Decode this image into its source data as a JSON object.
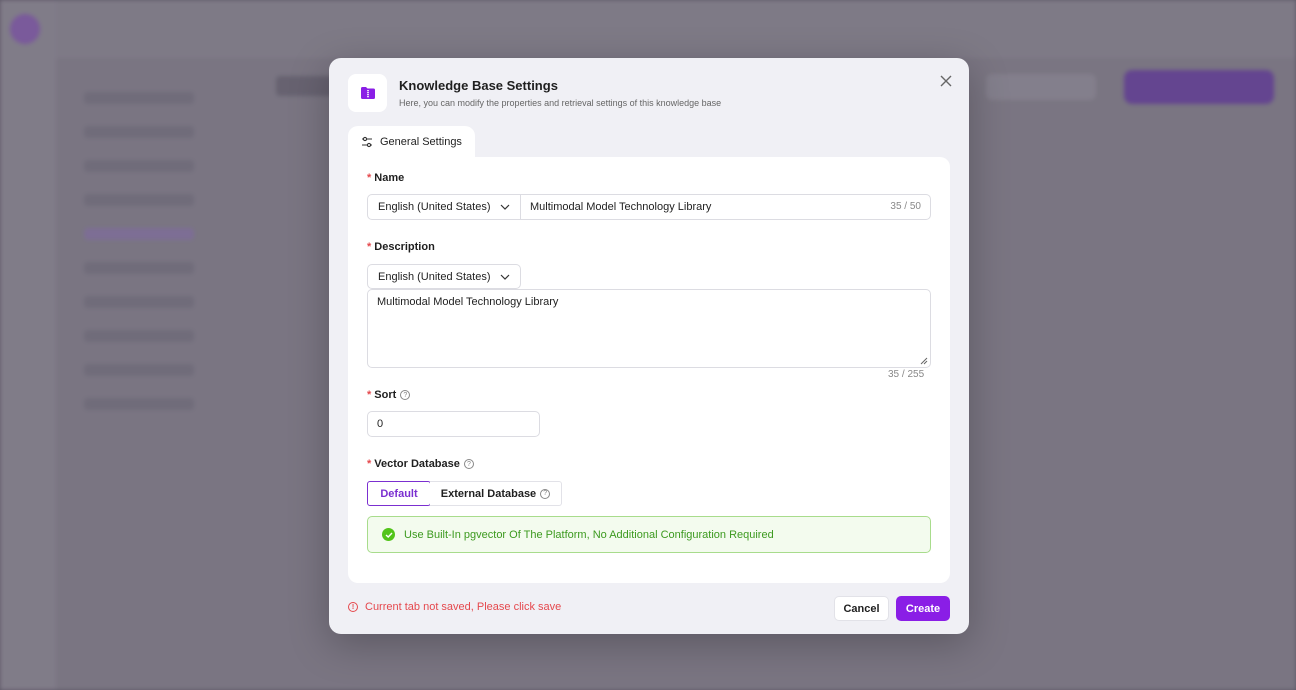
{
  "modal": {
    "title": "Knowledge Base Settings",
    "subtitle": "Here, you can modify the properties and retrieval settings of this knowledge base",
    "icon": "folder-icon",
    "accent_color": "#8a1ee6"
  },
  "tabs": [
    {
      "label": "General Settings",
      "icon": "sliders-icon",
      "active": true
    }
  ],
  "form": {
    "name": {
      "label": "Name",
      "language": "English (United States)",
      "value": "Multimodal Model Technology Library",
      "counter": "35 / 50"
    },
    "description": {
      "label": "Description",
      "language": "English (United States)",
      "value": "Multimodal Model Technology Library",
      "counter": "35 / 255"
    },
    "sort": {
      "label": "Sort",
      "value": "0"
    },
    "vector_database": {
      "label": "Vector Database",
      "options": [
        "Default",
        "External Database"
      ],
      "selected": "Default",
      "info": "Use Built-In pgvector Of The Platform, No Additional Configuration Required"
    }
  },
  "footer": {
    "warning": "Current tab not saved, Please click save",
    "cancel_label": "Cancel",
    "create_label": "Create"
  },
  "colors": {
    "required": "#e5484d",
    "success": "#52c41a",
    "primary": "#8a1ee6"
  }
}
